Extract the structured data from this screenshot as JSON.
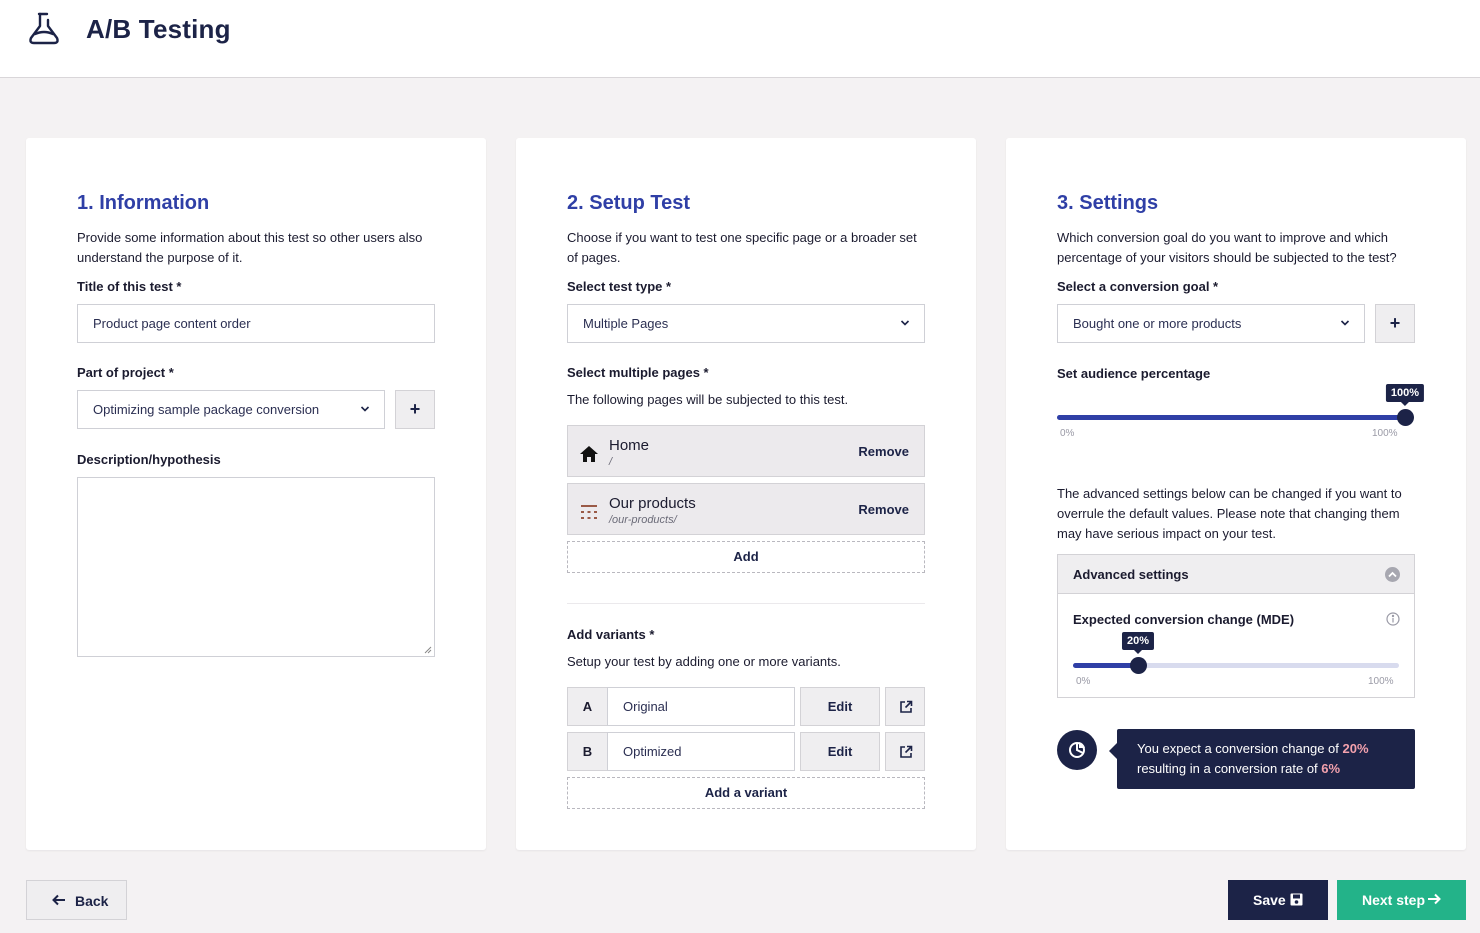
{
  "header": {
    "title": "A/B Testing",
    "logo_icon": "flask-icon"
  },
  "information": {
    "heading": "1. Information",
    "intro": "Provide some information about this test so other users also understand the purpose of it.",
    "title_label": "Title of this test *",
    "title_value": "Product page content order",
    "project_label": "Part of project *",
    "project_value": "Optimizing sample package conversion",
    "add_project_label": "+",
    "description_label": "Description/hypothesis",
    "description_value": ""
  },
  "setup": {
    "heading": "2. Setup Test",
    "intro": "Choose if you want to test one specific page or a broader set of pages.",
    "test_type_label": "Select test type *",
    "test_type_value": "Multiple Pages",
    "pages_label": "Select multiple pages *",
    "pages_sub": "The following pages will be subjected to this test.",
    "pages": [
      {
        "name": "Home",
        "path": "/",
        "icon": "home-icon",
        "action": "Remove"
      },
      {
        "name": "Our products",
        "path": "/our-products/",
        "icon": "grid-list-icon",
        "action": "Remove"
      }
    ],
    "add_page_label": "Add",
    "variants_label": "Add variants *",
    "variants_sub": "Setup your test by adding one or more variants.",
    "variants": [
      {
        "letter": "A",
        "name": "Original",
        "edit": "Edit"
      },
      {
        "letter": "B",
        "name": "Optimized",
        "edit": "Edit"
      }
    ],
    "add_variant_label": "Add a variant"
  },
  "settings": {
    "heading": "3. Settings",
    "intro": "Which conversion goal do you want to improve and which percentage of your visitors should be subjected to the test?",
    "goal_label": "Select a conversion goal *",
    "goal_value": "Bought one or more products",
    "add_goal_label": "+",
    "audience_label": "Set audience percentage",
    "audience": {
      "value": 100,
      "tip": "100%",
      "min": "0%",
      "max": "100%"
    },
    "advanced_intro": "The advanced settings below can be changed if you want to overrule the default values. Please note that changing them may have serious impact on your test.",
    "advanced_title": "Advanced settings",
    "mde_label": "Expected conversion change (MDE)",
    "mde": {
      "value": 20,
      "tip": "20%",
      "min": "0%",
      "max": "100%"
    },
    "summary_prefix": "You expect a conversion change of ",
    "summary_change": "20%",
    "summary_mid": "resulting in a conversion rate of ",
    "summary_rate": "6%"
  },
  "footer": {
    "back_label": "Back",
    "save_label": "Save",
    "next_label": "Next step"
  },
  "colors": {
    "primary": "#2f3fa6",
    "dark": "#1c2347",
    "success": "#23b389",
    "highlight": "#f3a1ad",
    "background": "#f4f2f3"
  }
}
